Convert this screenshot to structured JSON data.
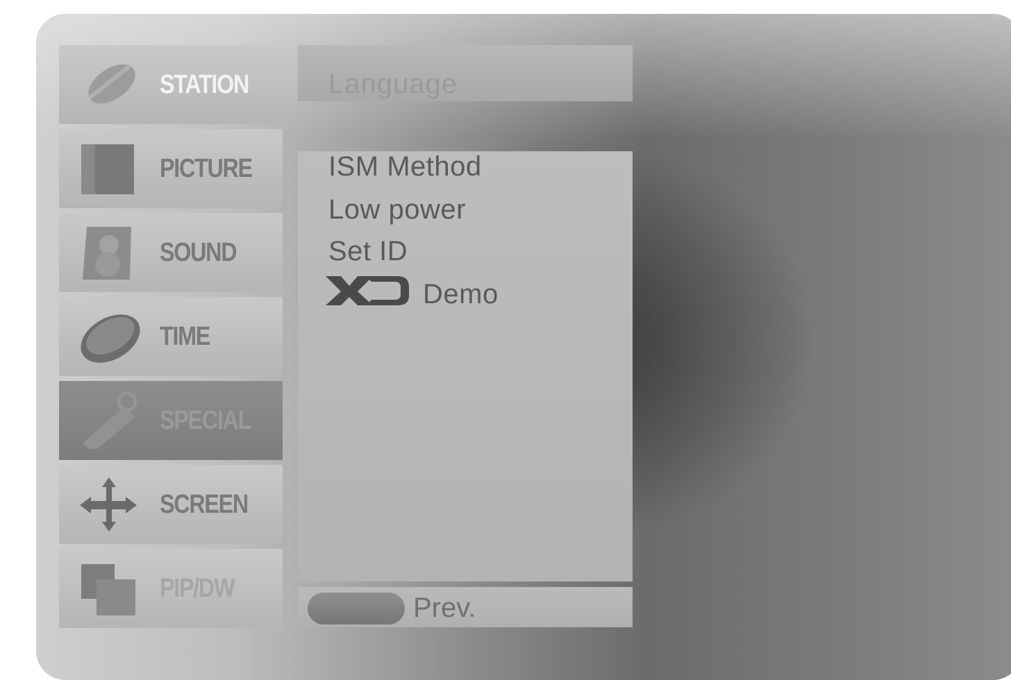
{
  "menu": {
    "items": [
      {
        "label": "STATION",
        "icon": "antenna-icon"
      },
      {
        "label": "PICTURE",
        "icon": "picture-icon"
      },
      {
        "label": "SOUND",
        "icon": "speaker-icon"
      },
      {
        "label": "TIME",
        "icon": "clock-icon"
      },
      {
        "label": "SPECIAL",
        "icon": "key-icon"
      },
      {
        "label": "SCREEN",
        "icon": "move-arrows-icon"
      },
      {
        "label": "PIP/DW",
        "icon": "pip-icon"
      }
    ],
    "selected": "SPECIAL"
  },
  "submenu": {
    "header": "Language",
    "options": {
      "ism": "ISM Method",
      "low_power": "Low power",
      "set_id": "Set ID",
      "xd_demo": "Demo"
    },
    "xd_logo": "XD"
  },
  "footer": {
    "prev_label": "Prev."
  },
  "colors": {
    "panel": "#b9b9b9",
    "selected_item": "#828282",
    "text": "#5a5a5a"
  }
}
